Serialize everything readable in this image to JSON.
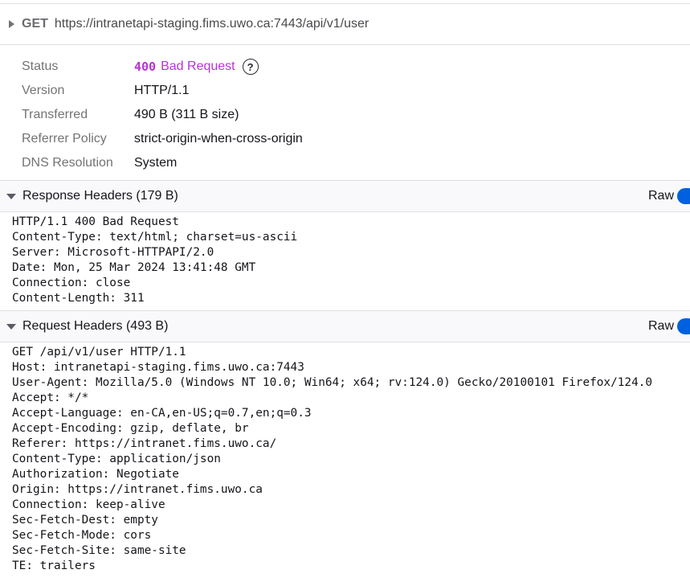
{
  "request": {
    "method": "GET",
    "url": "https://intranetapi-staging.fims.uwo.ca:7443/api/v1/user"
  },
  "summary": {
    "status_label": "Status",
    "status_code": "400",
    "status_text": "Bad Request",
    "version_label": "Version",
    "version_value": "HTTP/1.1",
    "transferred_label": "Transferred",
    "transferred_value": "490 B (311 B size)",
    "referrer_label": "Referrer Policy",
    "referrer_value": "strict-origin-when-cross-origin",
    "dns_label": "DNS Resolution",
    "dns_value": "System",
    "help_icon": "question-circle-icon",
    "status_color": "#b733d4"
  },
  "response_headers": {
    "title": "Response Headers (179 B)",
    "raw_label": "Raw",
    "lines": [
      "HTTP/1.1 400 Bad Request",
      "Content-Type: text/html; charset=us-ascii",
      "Server: Microsoft-HTTPAPI/2.0",
      "Date: Mon, 25 Mar 2024 13:41:48 GMT",
      "Connection: close",
      "Content-Length: 311"
    ]
  },
  "request_headers": {
    "title": "Request Headers (493 B)",
    "raw_label": "Raw",
    "lines": [
      "GET /api/v1/user HTTP/1.1",
      "Host: intranetapi-staging.fims.uwo.ca:7443",
      "User-Agent: Mozilla/5.0 (Windows NT 10.0; Win64; x64; rv:124.0) Gecko/20100101 Firefox/124.0",
      "Accept: */*",
      "Accept-Language: en-CA,en-US;q=0.7,en;q=0.3",
      "Accept-Encoding: gzip, deflate, br",
      "Referer: https://intranet.fims.uwo.ca/",
      "Content-Type: application/json",
      "Authorization: Negotiate",
      "Origin: https://intranet.fims.uwo.ca",
      "Connection: keep-alive",
      "Sec-Fetch-Dest: empty",
      "Sec-Fetch-Mode: cors",
      "Sec-Fetch-Site: same-site",
      "TE: trailers"
    ]
  },
  "colors": {
    "accent": "#0061e0",
    "status": "#b733d4"
  }
}
